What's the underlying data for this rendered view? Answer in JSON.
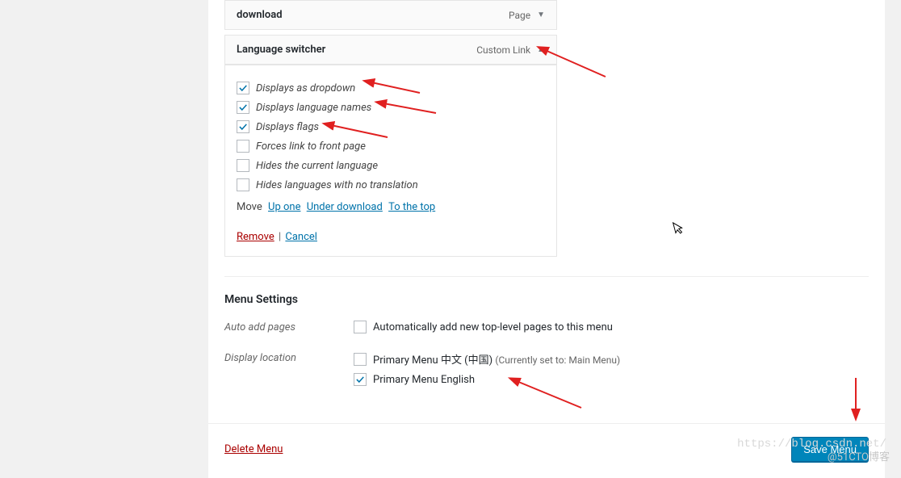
{
  "menuItem1": {
    "title": "download",
    "type": "Page"
  },
  "menuItem2": {
    "title": "Language switcher",
    "type": "Custom Link"
  },
  "options": {
    "dropdown": "Displays as dropdown",
    "names": "Displays language names",
    "flags": "Displays flags",
    "forceFront": "Forces link to front page",
    "hideCurrent": "Hides the current language",
    "hideNoTrans": "Hides languages with no translation"
  },
  "move": {
    "label": "Move",
    "upOne": "Up one",
    "underDownload": "Under download",
    "toTop": "To the top"
  },
  "actions": {
    "remove": "Remove",
    "cancel": "Cancel"
  },
  "menuSettings": {
    "title": "Menu Settings",
    "autoAdd": {
      "label": "Auto add pages",
      "option": "Automatically add new top-level pages to this menu"
    },
    "displayLocation": {
      "label": "Display location",
      "option1": "Primary Menu 中文 (中国)",
      "option1Note": "(Currently set to: Main Menu)",
      "option2": "Primary Menu English"
    }
  },
  "footer": {
    "delete": "Delete Menu",
    "save": "Save Menu"
  },
  "watermark": "https://blog.csdn.net/",
  "watermark2": "@51CTO博客"
}
